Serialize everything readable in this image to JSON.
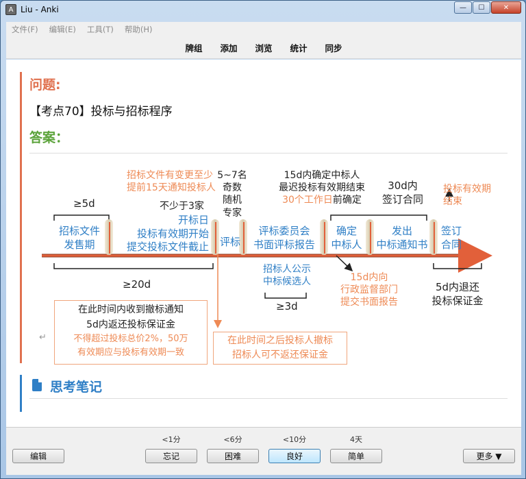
{
  "window": {
    "title": "Liu - Anki",
    "icon": "anki-app-icon",
    "min": "—",
    "max": "☐",
    "close": "✕"
  },
  "menu": [
    "文件(F)",
    "编辑(E)",
    "工具(T)",
    "帮助(H)"
  ],
  "toolbar": [
    "牌组",
    "添加",
    "浏览",
    "统计",
    "同步"
  ],
  "card": {
    "question_label": "问题:",
    "question_text": "【考点70】投标与招标程序",
    "answer_label": "答案：",
    "notes_label": "思考笔记",
    "return_mark": "↵"
  },
  "diagram": {
    "top_orange_1": "招标文件有变更至少",
    "top_orange_2": "提前15天通知投标人",
    "experts_1": "5~7名",
    "experts_2": "奇数",
    "experts_3": "随机",
    "experts_4": "专家",
    "confirm_1": "15d内确定中标人",
    "confirm_2": "最迟投标有效期结束",
    "confirm_3_orange": "30个工作日",
    "confirm_3_black": "前确定",
    "sign_1": "30d内",
    "sign_2": "签订合同",
    "valid_1": "投标有效期",
    "valid_2": "结束",
    "ge5d": "≥5d",
    "bidders_min": "不少于3家",
    "stage_1a": "招标文件",
    "stage_1b": "发售期",
    "stage_2a": "开标日",
    "stage_2b": "投标有效期开始",
    "stage_2c": "提交投标文件截止",
    "stage_3": "评标",
    "stage_4a": "评标委员会",
    "stage_4b": "书面评标报告",
    "stage_5a": "确定",
    "stage_5b": "中标人",
    "stage_6a": "发出",
    "stage_6b": "中标通知书",
    "stage_7a": "签订",
    "stage_7b": "合同",
    "ge20d": "≥20d",
    "publicity_1": "招标人公示",
    "publicity_2": "中标候选人",
    "ge3d": "≥3d",
    "report_1": "15d内向",
    "report_2": "行政监督部门",
    "report_3": "提交书面报告",
    "refund_1": "5d内退还",
    "refund_2": "投标保证金",
    "box1_line1": "在此时间内收到撤标通知",
    "box1_line2": "5d内返还投标保证金",
    "box1_line3": "不得超过投标总价2%，50万",
    "box1_line4": "有效期应与投标有效期一致",
    "box2_line1": "在此时间之后投标人撤标",
    "box2_line2": "招标人可不返还保证金"
  },
  "bottom": {
    "edit": "编辑",
    "answers": [
      {
        "due": "<1分",
        "label": "忘记"
      },
      {
        "due": "<6分",
        "label": "困难"
      },
      {
        "due": "<10分",
        "label": "良好"
      },
      {
        "due": "4天",
        "label": "简单"
      }
    ],
    "more": "更多 ▼"
  },
  "colors": {
    "orange": "#e0714f",
    "green": "#5ba33a",
    "blue": "#2f7fc6",
    "timeline": "#e2603a"
  }
}
